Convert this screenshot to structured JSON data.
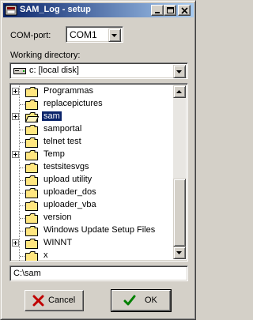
{
  "window": {
    "title": "SAM_Log - setup"
  },
  "com_port": {
    "label": "COM-port:",
    "value": "COM1"
  },
  "working_dir": {
    "label": "Working directory:",
    "drive": "c: [local disk]"
  },
  "tree": {
    "items": [
      {
        "label": "Programmas",
        "expandable": true,
        "open": false,
        "selected": false
      },
      {
        "label": "replacepictures",
        "expandable": false,
        "open": false,
        "selected": false
      },
      {
        "label": "sam",
        "expandable": true,
        "open": true,
        "selected": true
      },
      {
        "label": "samportal",
        "expandable": false,
        "open": false,
        "selected": false
      },
      {
        "label": "telnet test",
        "expandable": false,
        "open": false,
        "selected": false
      },
      {
        "label": "Temp",
        "expandable": true,
        "open": false,
        "selected": false
      },
      {
        "label": "testsitesvgs",
        "expandable": false,
        "open": false,
        "selected": false
      },
      {
        "label": "upload utility",
        "expandable": false,
        "open": false,
        "selected": false
      },
      {
        "label": "uploader_dos",
        "expandable": false,
        "open": false,
        "selected": false
      },
      {
        "label": "uploader_vba",
        "expandable": false,
        "open": false,
        "selected": false
      },
      {
        "label": "version",
        "expandable": false,
        "open": false,
        "selected": false
      },
      {
        "label": "Windows Update Setup Files",
        "expandable": false,
        "open": false,
        "selected": false
      },
      {
        "label": "WINNT",
        "expandable": true,
        "open": false,
        "selected": false
      },
      {
        "label": "x",
        "expandable": false,
        "open": false,
        "selected": false
      }
    ]
  },
  "path_field": {
    "value": "C:\\sam"
  },
  "buttons": {
    "cancel": "Cancel",
    "ok": "OK"
  },
  "colors": {
    "title_start": "#0a246a",
    "title_end": "#a6caf0",
    "face": "#d4d0c8",
    "selection": "#0a246a",
    "folder": "#ffe680",
    "cancel_icon": "#c00000",
    "ok_icon": "#008000"
  },
  "icons": {
    "app": "app-icon",
    "minimize": "minimize-icon",
    "maximize": "maximize-icon",
    "close": "close-icon",
    "drive": "drive-icon",
    "folder": "folder-icon",
    "cancel": "cross-icon",
    "ok": "checkmark-icon"
  }
}
